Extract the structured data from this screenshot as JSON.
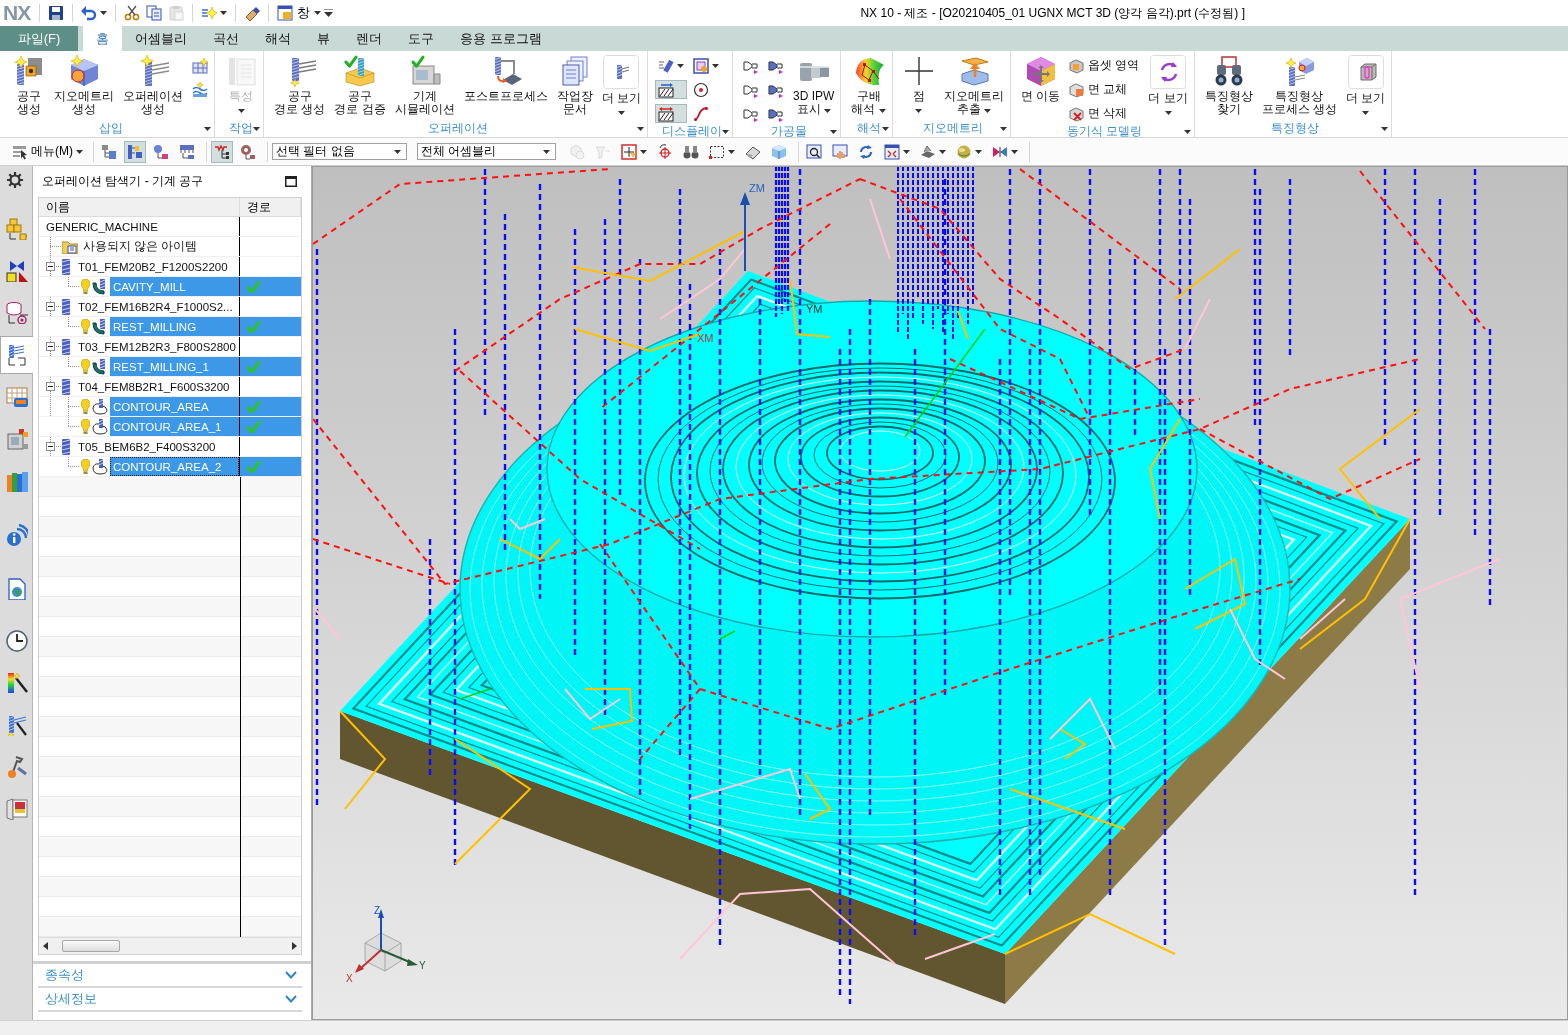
{
  "title_bar": {
    "logo": "NX",
    "quick_access": [
      {
        "dropdown": false,
        "disabled": false
      },
      {
        "dropdown": true,
        "disabled": false
      },
      {
        "dropdown": false,
        "disabled": false
      },
      {
        "dropdown": false,
        "disabled": false
      },
      {
        "dropdown": false,
        "disabled": true
      },
      {
        "dropdown": true,
        "disabled": false
      },
      {
        "dropdown": false,
        "disabled": false
      }
    ],
    "window_menu": "창",
    "title": "NX 10 - 제조 - [O20210405_01 UGNX MCT 3D (양각 음각).prt (수정됨) ]"
  },
  "menu_bar": {
    "file_button": "파일(F)",
    "tabs": [
      {
        "label": "홈",
        "selected": true
      },
      {
        "label": "어셈블리",
        "selected": false
      },
      {
        "label": "곡선",
        "selected": false
      },
      {
        "label": "해석",
        "selected": false
      },
      {
        "label": "뷰",
        "selected": false
      },
      {
        "label": "렌더",
        "selected": false
      },
      {
        "label": "도구",
        "selected": false
      },
      {
        "label": "응용 프로그램",
        "selected": false
      }
    ]
  },
  "ribbon": {
    "groups": [
      {
        "title": "삽입",
        "items": [
          {
            "kind": "large",
            "label": "공구\n생성",
            "dropdown": false
          },
          {
            "kind": "large",
            "label": "지오메트리\n생성",
            "dropdown": false
          },
          {
            "kind": "large",
            "label": "오퍼레이션\n생성",
            "dropdown": false
          },
          {
            "kind": "column",
            "buttons": [
              {
                "on": false,
                "dropdown": false
              },
              {
                "on": false,
                "dropdown": false
              }
            ]
          }
        ]
      },
      {
        "title": "작업",
        "items": [
          {
            "kind": "large",
            "label": "특성",
            "dropdown": true,
            "disabled": true
          }
        ]
      },
      {
        "title": "오퍼레이션",
        "items": [
          {
            "kind": "large",
            "label": "공구\n경로 생성",
            "dropdown": false
          },
          {
            "kind": "large",
            "label": "공구\n경로 검증",
            "dropdown": false
          },
          {
            "kind": "large",
            "label": "기계\n시뮬레이션",
            "dropdown": false
          },
          {
            "kind": "large",
            "label": "포스트프로세스",
            "dropdown": false
          },
          {
            "kind": "large",
            "label": "작업장\n문서",
            "dropdown": false
          },
          {
            "kind": "more",
            "label": "더 보기",
            "dropdown": true
          }
        ]
      },
      {
        "title": "디스플레이",
        "items": [
          {
            "kind": "column",
            "buttons": [
              {
                "on": false,
                "dropdown": true
              },
              {
                "on": true,
                "dropdown": false
              },
              {
                "on": true,
                "dropdown": false
              }
            ]
          },
          {
            "kind": "column",
            "buttons": [
              {
                "on": false,
                "dropdown": true
              },
              {
                "on": false,
                "dropdown": false
              },
              {
                "on": false,
                "dropdown": false
              }
            ]
          }
        ]
      },
      {
        "title": "가공물",
        "items": [
          {
            "kind": "column",
            "buttons": [
              {
                "on": false,
                "dropdown": false
              },
              {
                "on": false,
                "dropdown": false
              },
              {
                "on": false,
                "dropdown": false
              }
            ]
          },
          {
            "kind": "column",
            "buttons": [
              {
                "on": false,
                "dropdown": false
              },
              {
                "on": false,
                "dropdown": false
              },
              {
                "on": false,
                "dropdown": false
              }
            ]
          },
          {
            "kind": "large",
            "label": "3D IPW\n표시",
            "dropdown": true
          }
        ]
      },
      {
        "title": "해석",
        "items": [
          {
            "kind": "large",
            "label": "구배\n해석",
            "dropdown": true
          }
        ]
      },
      {
        "title": "지오메트리",
        "items": [
          {
            "kind": "large",
            "label": "점",
            "dropdown": true
          },
          {
            "kind": "large",
            "label": "지오메트리\n추출",
            "dropdown": true
          }
        ]
      },
      {
        "title": "동기식 모델링",
        "items": [
          {
            "kind": "large",
            "label": "면 이동",
            "dropdown": false
          },
          {
            "kind": "column",
            "buttons": [
              {
                "label": "옵셋 영역",
                "on": false,
                "dropdown": false
              },
              {
                "label": "면 교체",
                "on": false,
                "dropdown": false
              },
              {
                "label": "면 삭제",
                "on": false,
                "dropdown": false
              }
            ]
          },
          {
            "kind": "more",
            "label": "더 보기",
            "dropdown": true
          }
        ]
      },
      {
        "title": "특징형상",
        "items": [
          {
            "kind": "large",
            "label": "특징형상\n찾기",
            "dropdown": false
          },
          {
            "kind": "large",
            "label": "특징형상\n프로세스 생성",
            "dropdown": false
          },
          {
            "kind": "more",
            "label": "더 보기",
            "dropdown": true
          }
        ]
      }
    ]
  },
  "toolbar": {
    "groups": [
      {
        "items": [
          {
            "kind": "menu",
            "label": "메뉴(M)",
            "dropdown": true
          }
        ]
      },
      {
        "items": [
          {
            "kind": "icon",
            "on": false,
            "disabled": false,
            "dropdown": false
          },
          {
            "kind": "icon",
            "on": true,
            "disabled": false,
            "dropdown": false
          },
          {
            "kind": "icon",
            "on": false,
            "disabled": false,
            "dropdown": false
          },
          {
            "kind": "icon",
            "on": false,
            "disabled": false,
            "dropdown": false
          }
        ]
      },
      {
        "items": [
          {
            "kind": "icon",
            "on": true,
            "disabled": false,
            "dropdown": false
          },
          {
            "kind": "icon",
            "on": false,
            "disabled": false,
            "dropdown": false
          }
        ]
      },
      {
        "items": [
          {
            "kind": "select",
            "value": "선택 필터 없음"
          },
          {
            "kind": "select",
            "value": "전체 어셈블리"
          },
          {
            "kind": "icon",
            "on": false,
            "disabled": true,
            "dropdown": false
          },
          {
            "kind": "icon",
            "on": false,
            "disabled": true,
            "dropdown": false
          },
          {
            "kind": "icon",
            "on": false,
            "disabled": false,
            "dropdown": true
          },
          {
            "kind": "icon",
            "on": false,
            "disabled": false,
            "dropdown": false
          },
          {
            "kind": "icon",
            "on": false,
            "disabled": false,
            "dropdown": false
          },
          {
            "kind": "icon",
            "on": false,
            "disabled": false,
            "dropdown": true
          },
          {
            "kind": "icon",
            "on": false,
            "disabled": false,
            "dropdown": false
          },
          {
            "kind": "icon",
            "on": false,
            "disabled": false,
            "dropdown": false
          }
        ]
      },
      {
        "items": [
          {
            "kind": "icon",
            "on": false,
            "disabled": false,
            "dropdown": false
          },
          {
            "kind": "icon",
            "on": false,
            "disabled": false,
            "dropdown": false
          },
          {
            "kind": "icon",
            "on": false,
            "disabled": false,
            "dropdown": false
          },
          {
            "kind": "icon",
            "on": false,
            "disabled": false,
            "dropdown": true
          },
          {
            "kind": "icon",
            "on": false,
            "disabled": false,
            "dropdown": true
          },
          {
            "kind": "icon",
            "on": false,
            "disabled": false,
            "dropdown": true
          },
          {
            "kind": "icon",
            "on": false,
            "disabled": false,
            "dropdown": true
          }
        ]
      }
    ]
  },
  "resource_bar": {
    "tabs": [
      {
        "selected": false
      },
      {
        "selected": false
      },
      {
        "selected": false
      },
      {
        "selected": true
      },
      {
        "selected": false
      },
      {
        "selected": false
      },
      {
        "selected": false
      },
      {
        "selected": false
      },
      {
        "selected": false
      },
      {
        "selected": false
      },
      {
        "selected": false
      },
      {
        "selected": false
      },
      {
        "selected": false
      },
      {
        "selected": false
      }
    ]
  },
  "navigator": {
    "title": "오퍼레이션 탐색기 - 기계 공구",
    "columns": [
      "이름",
      "경로"
    ],
    "tree": [
      {
        "name": "GENERIC_MACHINE",
        "selected": false,
        "children": [
          {
            "kind": "folder",
            "name": "사용되지 않은 아이템",
            "selected": false
          },
          {
            "kind": "tool",
            "name": "T01_FEM20B2_F1200S2200",
            "selected": false,
            "expanded": true,
            "children": [
              {
                "kind": "cavity",
                "name": "CAVITY_MILL",
                "selected": true,
                "path_ok": true
              }
            ]
          },
          {
            "kind": "tool",
            "name": "T02_FEM16B2R4_F1000S2...",
            "selected": false,
            "expanded": true,
            "children": [
              {
                "kind": "cavity",
                "name": "REST_MILLING",
                "selected": true,
                "path_ok": true
              }
            ]
          },
          {
            "kind": "tool",
            "name": "T03_FEM12B2R3_F800S2800",
            "selected": false,
            "expanded": true,
            "children": [
              {
                "kind": "cavity",
                "name": "REST_MILLING_1",
                "selected": true,
                "path_ok": true
              }
            ]
          },
          {
            "kind": "tool",
            "name": "T04_FEM8B2R1_F600S3200",
            "selected": false,
            "expanded": true,
            "children": [
              {
                "kind": "contour",
                "name": "CONTOUR_AREA",
                "selected": true,
                "path_ok": true
              },
              {
                "kind": "contour",
                "name": "CONTOUR_AREA_1",
                "selected": true,
                "path_ok": true
              }
            ]
          },
          {
            "kind": "tool",
            "name": "T05_BEM6B2_F400S3200",
            "selected": false,
            "expanded": true,
            "children": [
              {
                "kind": "contour",
                "name": "CONTOUR_AREA_2",
                "selected": true,
                "path_ok": true,
                "focused": true
              }
            ]
          }
        ]
      }
    ],
    "sections": [
      {
        "label": "종속성",
        "expanded": false
      },
      {
        "label": "상세정보",
        "expanded": false
      }
    ]
  },
  "viewport": {
    "mcs_labels": [
      "ZM",
      "XM",
      "YM"
    ],
    "triad_labels": [
      "Z",
      "Y",
      "X"
    ]
  }
}
